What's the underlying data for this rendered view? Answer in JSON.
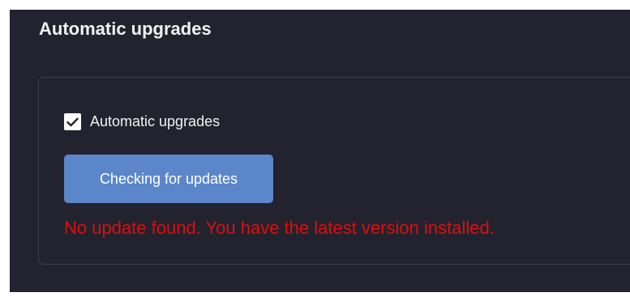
{
  "section": {
    "title": "Automatic upgrades"
  },
  "auto_upgrade": {
    "label": "Automatic upgrades",
    "checked": true
  },
  "check_button": {
    "label": "Checking for updates"
  },
  "status": {
    "message": "No update found. You have the latest version installed."
  },
  "colors": {
    "panel_background": "#22232e",
    "card_border": "#3d3f4c",
    "button_background": "#5b86c9",
    "error_text": "#e00d0d"
  }
}
